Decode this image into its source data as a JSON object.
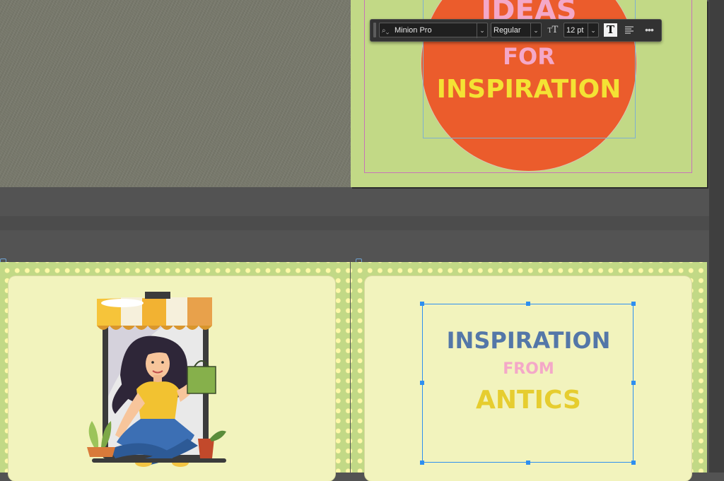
{
  "toolbar": {
    "font_family": "Minion Pro",
    "font_style": "Regular",
    "font_size": "12 pt",
    "icons": [
      "grip-icon",
      "search-icon",
      "chevron-down-icon",
      "text-size-icon",
      "text-frame-icon",
      "align-icon",
      "more-icon"
    ]
  },
  "top_page": {
    "line1": "IDEAS",
    "line2": "FOR",
    "line3": "INSPIRATION"
  },
  "bottom_right_card": {
    "line1": "INSPIRATION",
    "line2": "FROM",
    "line3": "ANTICS"
  },
  "illustration": "woman-shopping-illustration",
  "colors": {
    "page_green": "#c2d986",
    "card_fill": "#f2f3bd",
    "circle_orange": "#eb5c2c",
    "text_pink": "#f4a8c8",
    "text_yellow": "#f4e234",
    "text_blue": "#5477a8",
    "text_mustard": "#e6cd2f",
    "selection_blue": "#2e8ff0"
  }
}
